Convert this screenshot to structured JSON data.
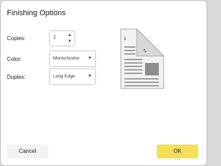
{
  "dialog": {
    "title": "Finishing Options"
  },
  "copies": {
    "label": "Copies:",
    "value": "1"
  },
  "color": {
    "label": "Color:",
    "selected": "Monochrome"
  },
  "duplex": {
    "label": "Duplex:",
    "selected": "Long Edge"
  },
  "preview": {
    "front_page_number": "1",
    "back_page_number": "2"
  },
  "buttons": {
    "cancel_label": "Cancel",
    "ok_label": "OK"
  },
  "colors": {
    "ok_button": "#f6df58",
    "cancel_button": "#f2f2f2",
    "page_fill": "#f2f2f2",
    "page_lines": "#9e9e9e"
  }
}
